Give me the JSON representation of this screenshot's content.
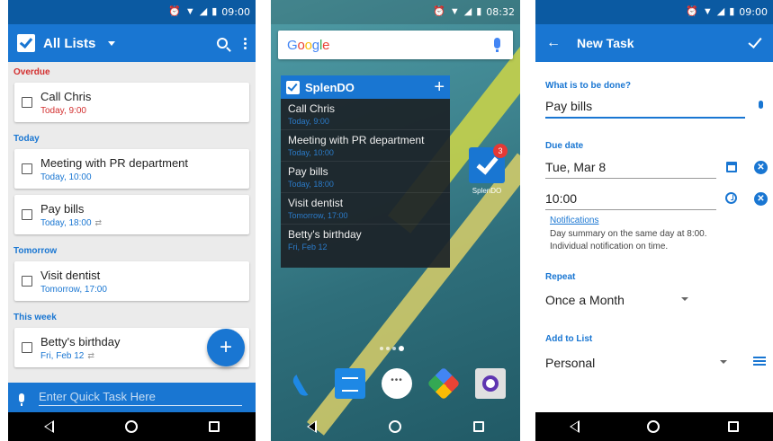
{
  "phone1": {
    "status_time": "09:00",
    "app_title": "All Lists",
    "sections": [
      {
        "label": "Overdue",
        "tasks": [
          {
            "name": "Call Chris",
            "date": "Today, 9:00",
            "repeat": false
          }
        ]
      },
      {
        "label": "Today",
        "tasks": [
          {
            "name": "Meeting with PR department",
            "date": "Today, 10:00",
            "repeat": false
          },
          {
            "name": "Pay bills",
            "date": "Today, 18:00",
            "repeat": true
          }
        ]
      },
      {
        "label": "Tomorrow",
        "tasks": [
          {
            "name": "Visit dentist",
            "date": "Tomorrow, 17:00",
            "repeat": false
          }
        ]
      },
      {
        "label": "This week",
        "tasks": [
          {
            "name": "Betty's birthday",
            "date": "Fri, Feb 12",
            "repeat": true
          }
        ]
      }
    ],
    "fab_label": "+",
    "quick_task_placeholder": "Enter Quick Task Here"
  },
  "phone2": {
    "status_time": "08:32",
    "search_brand": "Google",
    "widget_title": "SplenDO",
    "widget_add": "+",
    "widget_items": [
      {
        "name": "Call Chris",
        "date": "Today, 9:00"
      },
      {
        "name": "Meeting with PR department",
        "date": "Today, 10:00"
      },
      {
        "name": "Pay bills",
        "date": "Today, 18:00"
      },
      {
        "name": "Visit dentist",
        "date": "Tomorrow, 17:00"
      },
      {
        "name": "Betty's birthday",
        "date": "Fri, Feb 12"
      }
    ],
    "app_icon_label": "SplenDO",
    "app_badge": "3"
  },
  "phone3": {
    "status_time": "09:00",
    "title": "New Task",
    "what_label": "What is to be done?",
    "what_value": "Pay bills",
    "due_label": "Due date",
    "due_date": "Tue, Mar 8",
    "due_time": "10:00",
    "notifications_link": "Notifications",
    "notifications_line1": "Day summary on the same day at 8:00.",
    "notifications_line2": "Individual notification on time.",
    "repeat_label": "Repeat",
    "repeat_value": "Once a Month",
    "list_label": "Add to List",
    "list_value": "Personal"
  },
  "colors": {
    "primary": "#1976d2",
    "primary_dark": "#0b5aa2",
    "overdue_red": "#d32f2f"
  },
  "icons": [
    "alarm-icon",
    "wifi-icon",
    "signal-icon",
    "battery-icon",
    "search-icon",
    "more-vert-icon",
    "mic-icon",
    "back-icon",
    "home-icon",
    "recents-icon",
    "calendar-icon",
    "clock-icon",
    "clear-icon",
    "list-icon",
    "check-icon",
    "repeat-icon"
  ]
}
